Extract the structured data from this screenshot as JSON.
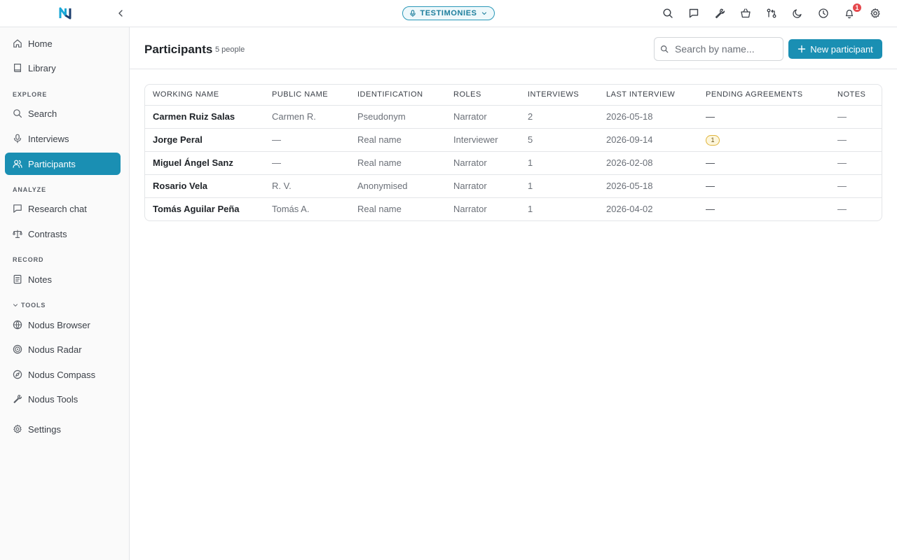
{
  "app": {
    "logo_letter": "N",
    "project": "TESTIMONIES",
    "notifications_count": "1"
  },
  "top_icons": [
    "search-icon",
    "chat-icon",
    "wrench-icon",
    "basket-icon",
    "git-compare-icon",
    "moon-icon",
    "clock-icon",
    "bell-icon",
    "gear-icon"
  ],
  "sidebar": {
    "home": "Home",
    "library": "Library",
    "sections": {
      "explore": "EXPLORE",
      "analyze": "ANALYZE",
      "record": "RECORD",
      "tools": "TOOLS"
    },
    "search": "Search",
    "interviews": "Interviews",
    "participants": "Participants",
    "research_chat": "Research chat",
    "contrasts": "Contrasts",
    "notes": "Notes",
    "nodus_browser": "Nodus Browser",
    "nodus_radar": "Nodus Radar",
    "nodus_compass": "Nodus Compass",
    "nodus_tools": "Nodus Tools",
    "settings": "Settings"
  },
  "page": {
    "title": "Participants",
    "count": "5 people",
    "search_placeholder": "Search by name...",
    "new_button": "New participant"
  },
  "table": {
    "headers": {
      "working_name": "WORKING NAME",
      "public_name": "PUBLIC NAME",
      "identification": "IDENTIFICATION",
      "roles": "ROLES",
      "interviews": "INTERVIEWS",
      "last_interview": "LAST INTERVIEW",
      "pending_agreements": "PENDING AGREEMENTS",
      "notes": "NOTES"
    },
    "rows": [
      {
        "working_name": "Carmen Ruiz Salas",
        "public_name": "Carmen R.",
        "identification": "Pseudonym",
        "roles": "Narrator",
        "interviews": "2",
        "last_interview": "2026-05-18",
        "pending": "—",
        "notes": "—"
      },
      {
        "working_name": "Jorge Peral",
        "public_name": "—",
        "identification": "Real name",
        "roles": "Interviewer",
        "interviews": "5",
        "last_interview": "2026-09-14",
        "pending": "1",
        "notes": "—"
      },
      {
        "working_name": "Miguel Ángel Sanz",
        "public_name": "—",
        "identification": "Real name",
        "roles": "Narrator",
        "interviews": "1",
        "last_interview": "2026-02-08",
        "pending": "—",
        "notes": "—"
      },
      {
        "working_name": "Rosario Vela",
        "public_name": "R. V.",
        "identification": "Anonymised",
        "roles": "Narrator",
        "interviews": "1",
        "last_interview": "2026-05-18",
        "pending": "—",
        "notes": "—"
      },
      {
        "working_name": "Tomás Aguilar Peña",
        "public_name": "Tomás A.",
        "identification": "Real name",
        "roles": "Narrator",
        "interviews": "1",
        "last_interview": "2026-04-02",
        "pending": "—",
        "notes": "—"
      }
    ]
  },
  "colors": {
    "accent": "#1a8fb3",
    "badge_red": "#e5484d",
    "agreement_badge": "#e0b43a"
  }
}
